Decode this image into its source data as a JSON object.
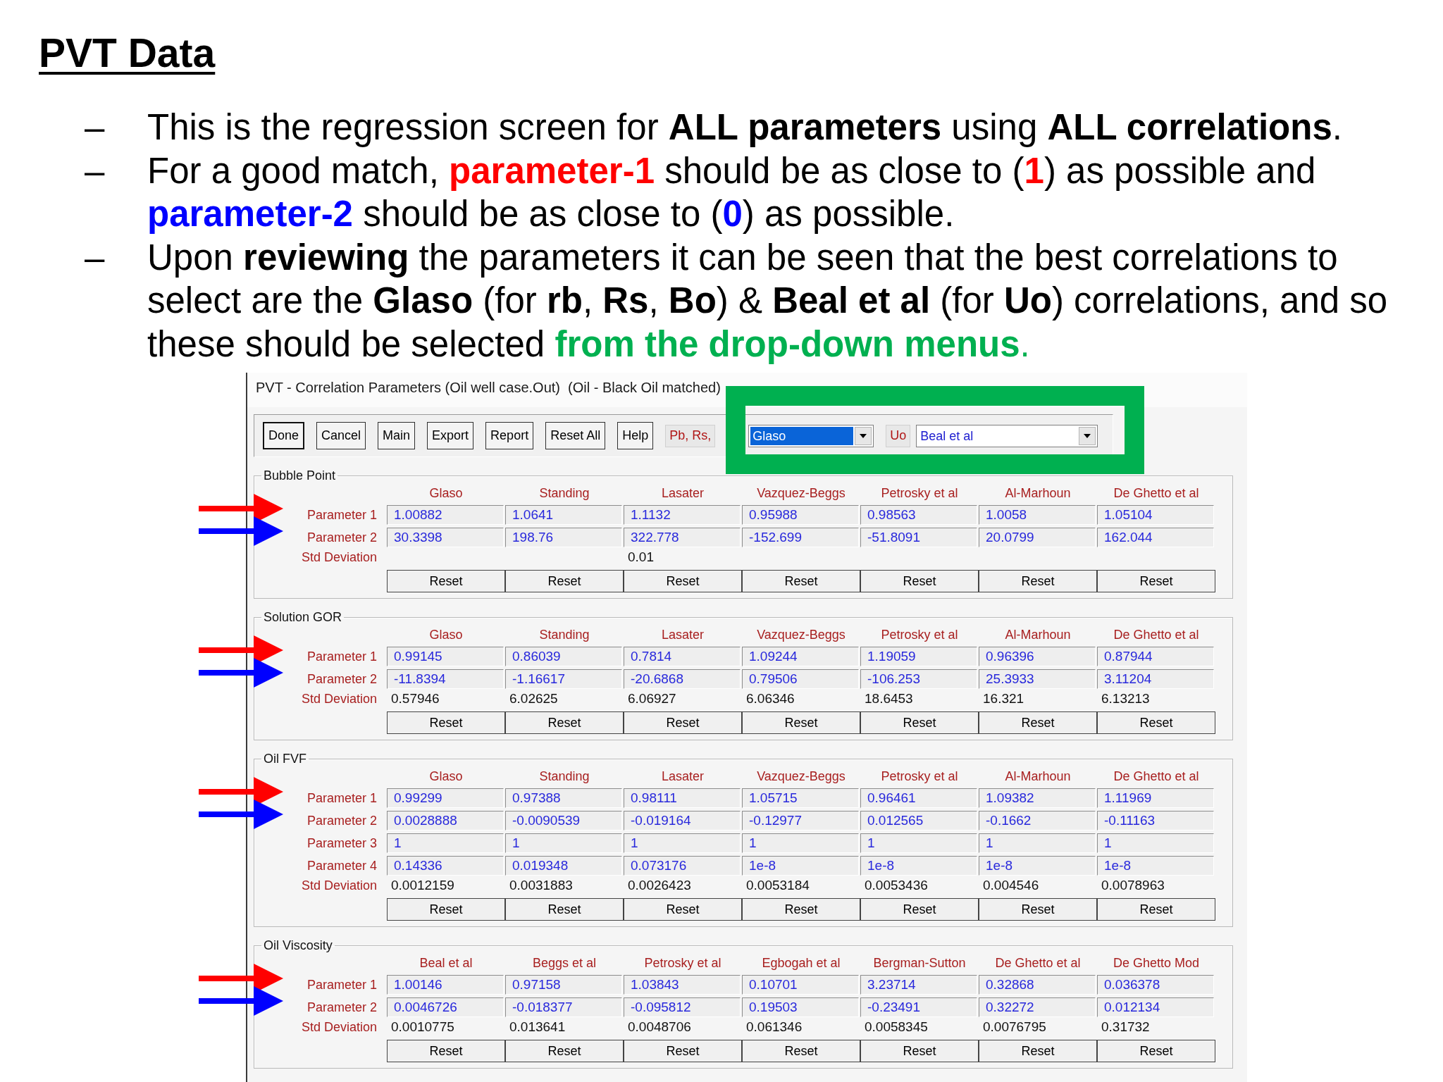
{
  "title": "PVT Data",
  "bullets": [
    {
      "marker": "–",
      "segments": [
        {
          "text": "This is the regression screen for **ALL parameters** using **ALL correlations**."
        }
      ]
    },
    {
      "marker": "–",
      "segments": [
        {
          "text": "For a good match, "
        },
        {
          "text": "**parameter-1**",
          "color": "#ff0000"
        },
        {
          "text": " should be as close to ("
        },
        {
          "text": "**1**",
          "color": "#ff0000"
        },
        {
          "text": ") as possible and "
        },
        {
          "text": "**parameter-2**",
          "color": "#0000ff"
        },
        {
          "text": " should be as close to ("
        },
        {
          "text": "**0**",
          "color": "#0000ff"
        },
        {
          "text": ") as possible."
        }
      ]
    },
    {
      "marker": "–",
      "segments": [
        {
          "text": "Upon **reviewing** the parameters it can be seen that the best correlations to select are the **Glaso** (for **rb**, **Rs**, **Bo**) & **Beal et al** (for **Uo**) correlations, and so these should be selected "
        },
        {
          "text": "**from the drop-down menus**.",
          "color": "#00b050"
        }
      ]
    }
  ],
  "window": {
    "title": "PVT - Correlation Parameters (Oil well case.Out)  (Oil - Black Oil matched)",
    "toolbar": [
      {
        "kind": "button",
        "label": "Done",
        "default": true
      },
      {
        "kind": "button",
        "label": "Cancel",
        "default": false
      },
      {
        "kind": "button",
        "label": "Main",
        "default": false
      },
      {
        "kind": "button",
        "label": "Export",
        "default": false
      },
      {
        "kind": "button",
        "label": "Report",
        "default": false
      },
      {
        "kind": "button",
        "label": "Reset All",
        "default": false
      },
      {
        "kind": "button",
        "label": "Help",
        "default": false
      },
      {
        "kind": "option",
        "label": "Pb, Rs,"
      },
      {
        "kind": "dropdown",
        "value": "Glaso",
        "selected": true
      },
      {
        "kind": "option",
        "label": "Uo"
      },
      {
        "kind": "dropdown",
        "value": "Beal et al",
        "selected": false
      }
    ],
    "sections": [
      {
        "title": "Bubble Point",
        "columns": [
          {
            "header": "Glaso"
          },
          {
            "header": "Standing"
          },
          {
            "header": "Lasater",
            "std_deviation": "0.01"
          },
          {
            "header": "Vazquez-Beggs"
          },
          {
            "header": "Petrosky et al"
          },
          {
            "header": "Al-Marhoun"
          },
          {
            "header": "De Ghetto et al"
          }
        ],
        "rows": [
          {
            "label": "Parameter 1",
            "arrow": {
              "color": "#ff0000"
            },
            "values": [
              "1.00882",
              "1.0641",
              "1.1132",
              "0.95988",
              "0.98563",
              "1.0058",
              "1.05104"
            ]
          },
          {
            "label": "Parameter 2",
            "arrow": {
              "color": "#0000ff"
            },
            "values": [
              "30.3398",
              "198.76",
              "322.778",
              "-152.699",
              "-51.8091",
              "20.0799",
              "162.044"
            ]
          }
        ],
        "std_label": "Std Deviation",
        "resets": [
          "Reset",
          "Reset",
          "Reset",
          "Reset",
          "Reset",
          "Reset",
          "Reset"
        ]
      },
      {
        "title": "Solution GOR",
        "columns": [
          {
            "header": "Glaso",
            "std_deviation": "0.57946"
          },
          {
            "header": "Standing",
            "std_deviation": "6.02625"
          },
          {
            "header": "Lasater",
            "std_deviation": "6.06927"
          },
          {
            "header": "Vazquez-Beggs",
            "std_deviation": "6.06346"
          },
          {
            "header": "Petrosky et al",
            "std_deviation": "18.6453"
          },
          {
            "header": "Al-Marhoun",
            "std_deviation": "16.321"
          },
          {
            "header": "De Ghetto et al",
            "std_deviation": "6.13213"
          }
        ],
        "rows": [
          {
            "label": "Parameter 1",
            "arrow": {
              "color": "#ff0000"
            },
            "values": [
              "0.99145",
              "0.86039",
              "0.7814",
              "1.09244",
              "1.19059",
              "0.96396",
              "0.87944"
            ]
          },
          {
            "label": "Parameter 2",
            "arrow": {
              "color": "#0000ff"
            },
            "values": [
              "-11.8394",
              "-1.16617",
              "-20.6868",
              "0.79506",
              "-106.253",
              "25.3933",
              "3.11204"
            ]
          }
        ],
        "std_label": "Std Deviation",
        "resets": [
          "Reset",
          "Reset",
          "Reset",
          "Reset",
          "Reset",
          "Reset",
          "Reset"
        ]
      },
      {
        "title": "Oil FVF",
        "columns": [
          {
            "header": "Glaso",
            "std_deviation": "0.0012159"
          },
          {
            "header": "Standing",
            "std_deviation": "0.0031883"
          },
          {
            "header": "Lasater",
            "std_deviation": "0.0026423"
          },
          {
            "header": "Vazquez-Beggs",
            "std_deviation": "0.0053184"
          },
          {
            "header": "Petrosky et al",
            "std_deviation": "0.0053436"
          },
          {
            "header": "Al-Marhoun",
            "std_deviation": "0.004546"
          },
          {
            "header": "De Ghetto et al",
            "std_deviation": "0.0078963"
          }
        ],
        "rows": [
          {
            "label": "Parameter 1",
            "arrow": {
              "color": "#ff0000"
            },
            "values": [
              "0.99299",
              "0.97388",
              "0.98111",
              "1.05715",
              "0.96461",
              "1.09382",
              "1.11969"
            ]
          },
          {
            "label": "Parameter 2",
            "arrow": {
              "color": "#0000ff"
            },
            "values": [
              "0.0028888",
              "-0.0090539",
              "-0.019164",
              "-0.12977",
              "0.012565",
              "-0.1662",
              "-0.11163"
            ]
          },
          {
            "label": "Parameter 3",
            "values": [
              "1",
              "1",
              "1",
              "1",
              "1",
              "1",
              "1"
            ]
          },
          {
            "label": "Parameter 4",
            "values": [
              "0.14336",
              "0.019348",
              "0.073176",
              "1e-8",
              "1e-8",
              "1e-8",
              "1e-8"
            ]
          }
        ],
        "std_label": "Std Deviation",
        "resets": [
          "Reset",
          "Reset",
          "Reset",
          "Reset",
          "Reset",
          "Reset",
          "Reset"
        ]
      },
      {
        "title": "Oil Viscosity",
        "columns": [
          {
            "header": "Beal et al",
            "std_deviation": "0.0010775"
          },
          {
            "header": "Beggs et al",
            "std_deviation": "0.013641"
          },
          {
            "header": "Petrosky et al",
            "std_deviation": "0.0048706"
          },
          {
            "header": "Egbogah et al",
            "std_deviation": "0.061346"
          },
          {
            "header": "Bergman-Sutton",
            "std_deviation": "0.0058345"
          },
          {
            "header": "De Ghetto et al",
            "std_deviation": "0.0076795"
          },
          {
            "header": "De Ghetto Mod",
            "std_deviation": "0.31732"
          }
        ],
        "rows": [
          {
            "label": "Parameter 1",
            "arrow": {
              "color": "#ff0000"
            },
            "values": [
              "1.00146",
              "0.97158",
              "1.03843",
              "0.10701",
              "3.23714",
              "0.32868",
              "0.036378"
            ]
          },
          {
            "label": "Parameter 2",
            "arrow": {
              "color": "#0000ff"
            },
            "values": [
              "0.0046726",
              "-0.018377",
              "-0.095812",
              "0.19503",
              "-0.23491",
              "0.32272",
              "0.012134"
            ]
          }
        ],
        "std_label": "Std Deviation",
        "resets": [
          "Reset",
          "Reset",
          "Reset",
          "Reset",
          "Reset",
          "Reset",
          "Reset"
        ]
      }
    ]
  }
}
